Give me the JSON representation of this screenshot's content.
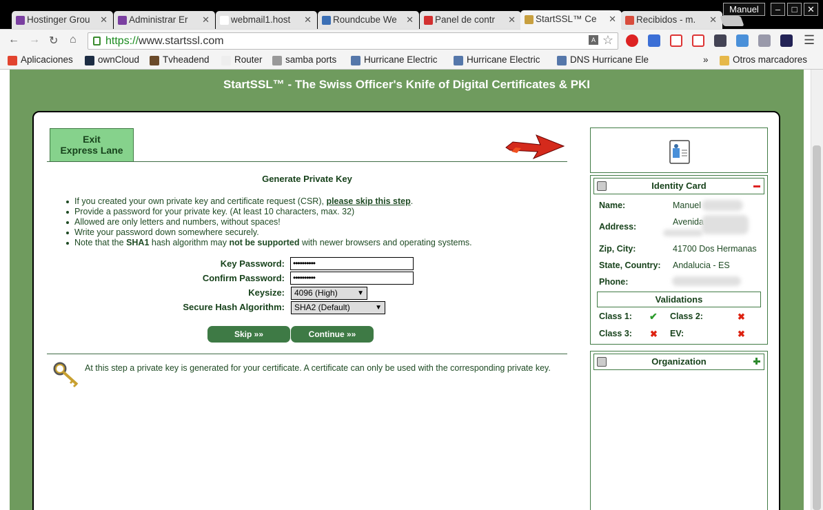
{
  "browser": {
    "tabs": [
      {
        "label": "Hostinger Grou",
        "color": "#7a3fa0"
      },
      {
        "label": "Administrar Er",
        "color": "#7a3fa0"
      },
      {
        "label": "webmail1.host",
        "color": "#ffffff"
      },
      {
        "label": "Roundcube We",
        "color": "#3b6fb5"
      },
      {
        "label": "Panel de contr",
        "color": "#d23030"
      },
      {
        "label": "StartSSL™ Ce",
        "color": "#c8a040"
      },
      {
        "label": "Recibidos - m.",
        "color": "#d84c3c"
      }
    ],
    "user": "Manuel",
    "window_minimize": "–",
    "window_maximize": "□",
    "window_close": "✕",
    "url_scheme": "https://",
    "url_host": "www.startssl.com",
    "bookmarks": [
      {
        "label": "Aplicaciones",
        "color": "#e2442f"
      },
      {
        "label": "ownCloud",
        "color": "#1d2d44"
      },
      {
        "label": "Tvheadend",
        "color": "#6a4a2a"
      },
      {
        "label": "Router",
        "color": "#eeeeee"
      },
      {
        "label": "samba ports",
        "color": "#999999"
      },
      {
        "label": "Hurricane Electric",
        "color": "#5577aa"
      },
      {
        "label": "Hurricane Electric",
        "color": "#5577aa"
      },
      {
        "label": "DNS Hurricane Ele",
        "color": "#5577aa"
      }
    ],
    "bookmarks_more": "»",
    "other_bookmarks": "Otros marcadores"
  },
  "site": {
    "title": "StartSSL™ - The Swiss Officer's Knife of Digital Certificates & PKI"
  },
  "main": {
    "exit_lane_line1": "Exit",
    "exit_lane_line2": "Express Lane",
    "heading": "Generate Private Key",
    "step1_pre": "If you created your own private key and certificate request (CSR), ",
    "step1_link": "please skip this step",
    "step1_post": ".",
    "step2": "Provide a password for your private key. (At least 10 characters, max. 32)",
    "step3": "Allowed are only letters and numbers, without spaces!",
    "step4": "Write your password down somewhere securely.",
    "step5_a": "Note that the ",
    "step5_b": "SHA1",
    "step5_c": " hash algorithm may ",
    "step5_d": "not be supported",
    "step5_e": " with newer browsers and operating systems.",
    "form": {
      "key_password_label": "Key Password:",
      "key_password_value": "••••••••••",
      "confirm_password_label": "Confirm Password:",
      "confirm_password_value": "••••••••••",
      "keysize_label": "Keysize:",
      "keysize_value": "4096 (High)",
      "hash_label": "Secure Hash Algorithm:",
      "hash_value": "SHA2 (Default)"
    },
    "skip_button": "Skip »»",
    "continue_button": "Continue »»",
    "info": "At this step a private key is generated for your certificate. A certificate can only be used with the corresponding private key."
  },
  "sidebar": {
    "identity_title": "Identity Card",
    "name_label": "Name:",
    "name_value": "Manuel",
    "address_label": "Address:",
    "address_value": "Avenida",
    "zip_label": "Zip, City:",
    "zip_value": "41700 Dos Hermanas",
    "state_label": "State, Country:",
    "state_value": "Andalucia - ES",
    "phone_label": "Phone:",
    "validations_title": "Validations",
    "class1_label": "Class 1:",
    "class2_label": "Class 2:",
    "class3_label": "Class 3:",
    "ev_label": "EV:",
    "organization_title": "Organization"
  }
}
